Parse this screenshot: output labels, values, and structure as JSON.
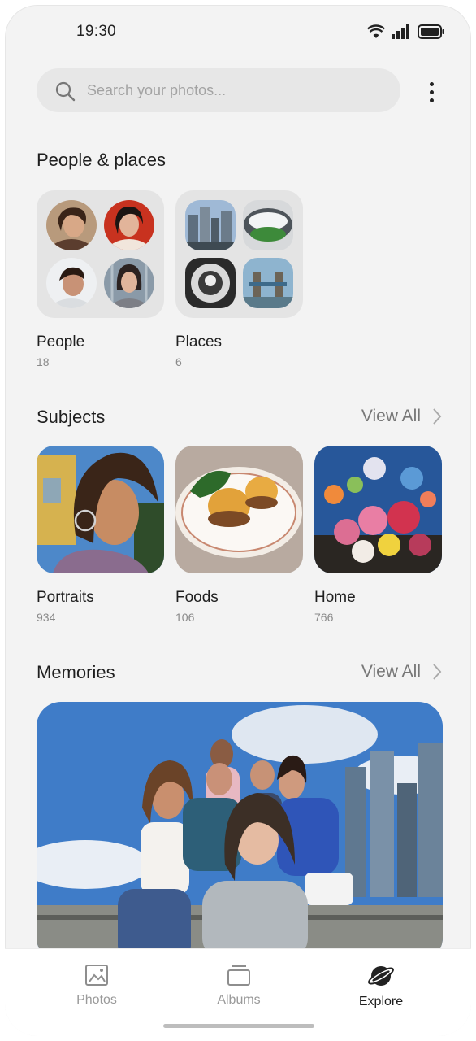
{
  "status_bar": {
    "time": "19:30"
  },
  "search": {
    "placeholder": "Search your photos..."
  },
  "sections": {
    "people_places": {
      "title": "People & places",
      "tiles": [
        {
          "label": "People",
          "count": "18"
        },
        {
          "label": "Places",
          "count": "6"
        }
      ]
    },
    "subjects": {
      "title": "Subjects",
      "view_all": "View All",
      "tiles": [
        {
          "label": "Portraits",
          "count": "934"
        },
        {
          "label": "Foods",
          "count": "106"
        },
        {
          "label": "Home",
          "count": "766"
        }
      ]
    },
    "memories": {
      "title": "Memories",
      "view_all": "View All"
    }
  },
  "bottom_nav": {
    "items": [
      {
        "label": "Photos",
        "icon": "photo-icon",
        "active": false
      },
      {
        "label": "Albums",
        "icon": "albums-icon",
        "active": false
      },
      {
        "label": "Explore",
        "icon": "planet-icon",
        "active": true
      }
    ]
  }
}
